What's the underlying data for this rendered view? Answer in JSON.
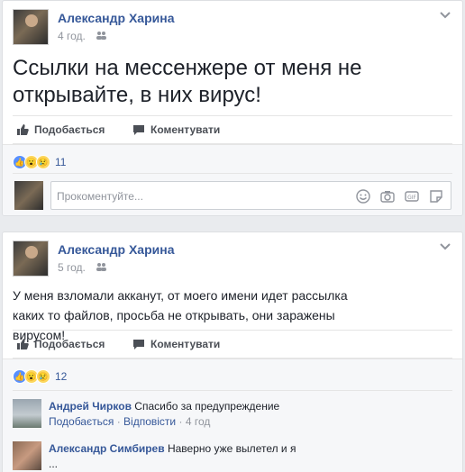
{
  "post1": {
    "author": "Александр Харина",
    "time": "4 год.",
    "text": "Ссылки на мессенжере от меня не открывайте, в них вирус!",
    "like_label": "Подобається",
    "comment_label": "Коментувати",
    "reaction_count": "11",
    "comment_placeholder": "Прокоментуйте..."
  },
  "post2": {
    "author": "Александр Харина",
    "time": "5 год.",
    "text": "У меня взломали акканут, от моего имени идет рассылка каких то файлов, просьба не открывать, они заражены вирусом!",
    "like_label": "Подобається",
    "comment_label": "Коментувати",
    "reaction_count": "12",
    "comments": [
      {
        "author": "Андрей Чирков",
        "text": "Спасибо за предупреждение",
        "like": "Подобається",
        "reply": "Відповісти",
        "sep": "·",
        "time": "4 год"
      },
      {
        "author": "Александр Симбирев",
        "text": "Наверно уже вылетел и я",
        "more": "..."
      }
    ]
  },
  "colors": {
    "link": "#365899",
    "muted": "#90949c",
    "like_blue": "#5890ff"
  }
}
